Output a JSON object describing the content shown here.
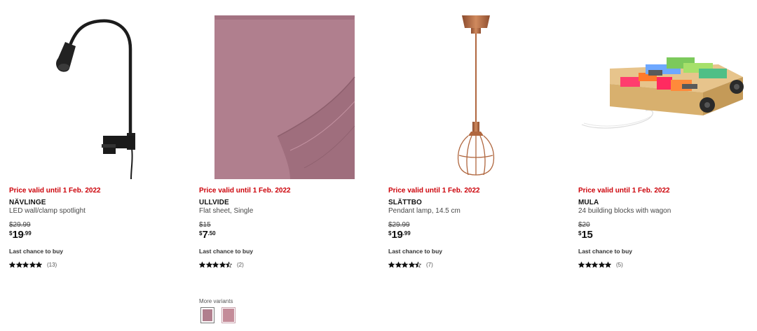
{
  "products": [
    {
      "promo": "Price valid until 1 Feb. 2022",
      "name": "NÄVLINGE",
      "description": "LED wall/clamp spotlight",
      "old_price": "$29.99",
      "price": {
        "currency": "$",
        "integer": "19",
        "decimal": ".99"
      },
      "availability": "Last chance to buy",
      "rating": 5,
      "review_count": "(13)",
      "image_icon": "clamp-spotlight-image"
    },
    {
      "promo": "Price valid until 1 Feb. 2022",
      "name": "ULLVIDE",
      "description": "Flat sheet, Single",
      "old_price": "$15",
      "price": {
        "currency": "$",
        "integer": "7",
        "decimal": ".50"
      },
      "availability": "Last chance to buy",
      "rating": 4.5,
      "review_count": "(2)",
      "image_icon": "flat-sheet-image",
      "variants": {
        "label": "More variants",
        "swatch_colors": [
          "#b07f8e",
          "#c48c99"
        ]
      }
    },
    {
      "promo": "Price valid until 1 Feb. 2022",
      "name": "SLÄTTBO",
      "description": "Pendant lamp, 14.5 cm",
      "old_price": "$29.99",
      "price": {
        "currency": "$",
        "integer": "19",
        "decimal": ".99"
      },
      "availability": "Last chance to buy",
      "rating": 4.5,
      "review_count": "(7)",
      "image_icon": "pendant-lamp-image"
    },
    {
      "promo": "Price valid until 1 Feb. 2022",
      "name": "MULA",
      "description": "24 building blocks with wagon",
      "old_price": "$20",
      "price": {
        "currency": "$",
        "integer": "15",
        "decimal": ""
      },
      "availability": "Last chance to buy",
      "rating": 5,
      "review_count": "(5)",
      "image_icon": "building-blocks-wagon-image"
    }
  ],
  "colors": {
    "promo_red": "#cc0008",
    "text_dark": "#111111",
    "text_muted": "#484848",
    "sheet_pink": "#b07f8e",
    "copper": "#b0673f"
  }
}
